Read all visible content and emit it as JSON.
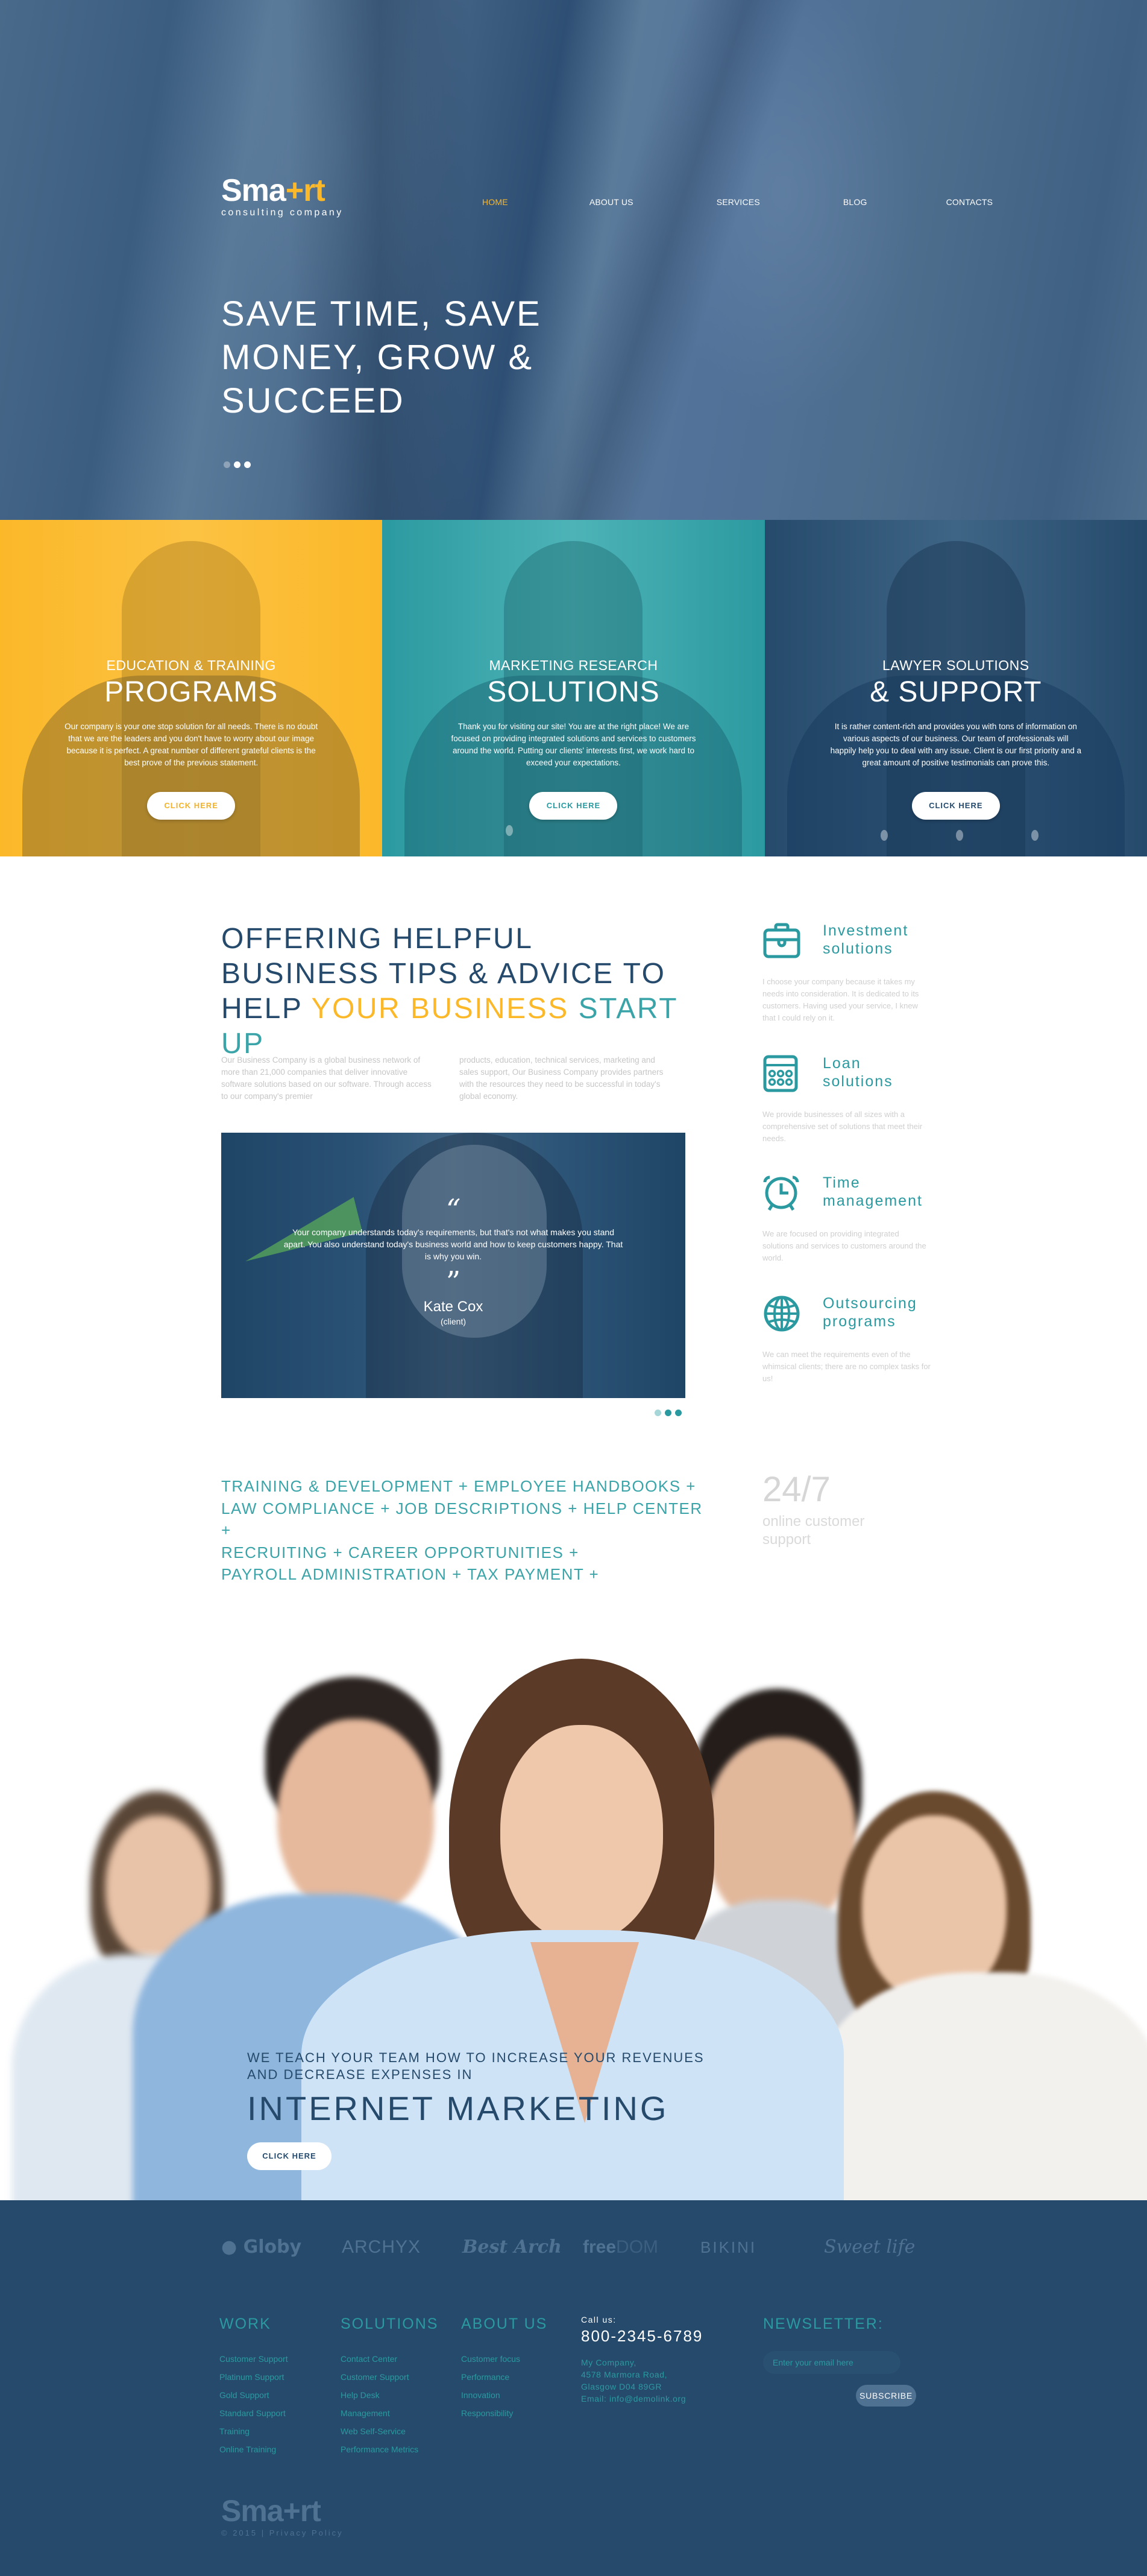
{
  "brand": {
    "name_part1": "Sma",
    "name_plus": "+",
    "name_part2": "rt",
    "tagline": "consulting company",
    "accent": "#fbb829",
    "primary": "#254a6b",
    "teal": "#2b9aa0"
  },
  "nav": {
    "items": [
      {
        "label": "HOME",
        "active": true
      },
      {
        "label": "ABOUT US",
        "active": false
      },
      {
        "label": "SERVICES",
        "active": false
      },
      {
        "label": "BLOG",
        "active": false
      },
      {
        "label": "CONTACTS",
        "active": false
      }
    ]
  },
  "hero": {
    "title_lines": [
      "SAVE TIME, SAVE",
      "MONEY, GROW &",
      "SUCCEED"
    ],
    "slider_total": 3,
    "slider_active": 1
  },
  "panels": [
    {
      "subtitle": "EDUCATION & TRAINING",
      "title": "PROGRAMS",
      "text": "Our company is your one stop solution for all needs. There is no doubt that we are the leaders and you don't have to worry about our image because it is perfect. A great number of different grateful clients is the best prove of the previous statement.",
      "button": "CLICK HERE",
      "color": "#fbb829"
    },
    {
      "subtitle": "MARKETING RESEARCH",
      "title": "SOLUTIONS",
      "text": "Thank you for visiting our site! You are at the right place! We are focused on providing integrated solutions and services to customers around the world. Putting our clients' interests first, we work hard to exceed your expectations.",
      "button": "CLICK HERE",
      "color": "#2b9aa0"
    },
    {
      "subtitle": "LAWYER SOLUTIONS",
      "title": "& SUPPORT",
      "text": "It is rather content-rich and provides you with tons of information on various aspects of our business. Our team of professionals will happily help you to deal with any issue. Client is our first priority and a great amount of positive testimonials can prove this.",
      "button": "CLICK HERE",
      "color": "#254a6b"
    }
  ],
  "about": {
    "title_dark": "OFFERING HELPFUL BUSINESS TIPS & ADVICE TO HELP ",
    "title_yellow": "YOUR BUSINESS",
    "title_teal": "START UP",
    "col1": "Our Business Company is a global business network of more than 21,000 companies that deliver innovative software solutions based on our software. Through access to our company's premier",
    "col2": "products, education, technical services, marketing and sales support, Our Business Company provides partners with the resources they need to be successful in today's global economy."
  },
  "testimonial": {
    "open_quote": "“",
    "text": "Your company understands today's requirements, but that's not what makes you stand apart. You also understand today's business world and how to keep customers happy. That is why you win.",
    "close_quote": "”",
    "name": "Kate Cox",
    "role": "(client)",
    "slider_total": 3,
    "slider_active": 0
  },
  "services": [
    {
      "icon": "briefcase-icon",
      "name_l1": "Investment",
      "name_l2": "solutions",
      "text": "I choose your company because it takes my needs into consideration. It is dedicated to its customers. Having used your service, I knew that I could rely on it."
    },
    {
      "icon": "calculator-icon",
      "name_l1": "Loan",
      "name_l2": "solutions",
      "text": "We provide businesses of all sizes with a comprehensive set of solutions that meet their needs."
    },
    {
      "icon": "alarm-clock-icon",
      "name_l1": "Time",
      "name_l2": "management",
      "text": "We are focused on providing integrated solutions and services to customers around the world."
    },
    {
      "icon": "globe-icon",
      "name_l1": "Outsourcing",
      "name_l2": "programs",
      "text": "We can meet the requirements even of the whimsical clients; there are no complex tasks for us!"
    }
  ],
  "tags": {
    "lines": [
      "TRAINING & DEVELOPMENT + EMPLOYEE HANDBOOKS +",
      "LAW COMPLIANCE + JOB DESCRIPTIONS + HELP CENTER +",
      "RECRUITING + CAREER OPPORTUNITIES +",
      "PAYROLL ADMINISTRATION + TAX PAYMENT +"
    ]
  },
  "support": {
    "number": "24/7",
    "label": "online customer support"
  },
  "team_banner": {
    "line1": "WE TEACH YOUR TEAM HOW TO INCREASE YOUR REVENUES AND DECREASE EXPENSES IN",
    "line2": "INTERNET MARKETING",
    "button": "CLICK HERE"
  },
  "footer": {
    "brands": {
      "b0": "Globy",
      "b1": "ARCHYX",
      "b2": "Best Arch",
      "b3a": "free",
      "b3b": "DOM",
      "b4": "BIKINI",
      "b5": "Sweet life"
    },
    "columns": [
      {
        "title": "WORK",
        "links": [
          "Customer Support",
          "Platinum Support",
          "Gold Support",
          "Standard Support",
          "Training",
          "Online Training"
        ]
      },
      {
        "title": "SOLUTIONS",
        "links": [
          "Contact Center",
          "Customer Support",
          "Help Desk",
          "Management",
          "Web Self-Service",
          "Performance Metrics"
        ]
      },
      {
        "title": "ABOUT US",
        "links": [
          "Customer focus",
          "Performance",
          "Innovation",
          "Responsibility"
        ]
      }
    ],
    "contact": {
      "call_label": "Call us:",
      "phone": "800-2345-6789",
      "company": "My Company,",
      "street": "4578 Marmora Road,",
      "city": "Glasgow D04 89GR",
      "email": "Email: info@demolink.org"
    },
    "newsletter": {
      "title": "NEWSLETTER:",
      "placeholder": "Enter your email here",
      "value": "",
      "button": "SUBSCRIBE"
    },
    "copyright": "© 2015 | Privacy Policy"
  }
}
